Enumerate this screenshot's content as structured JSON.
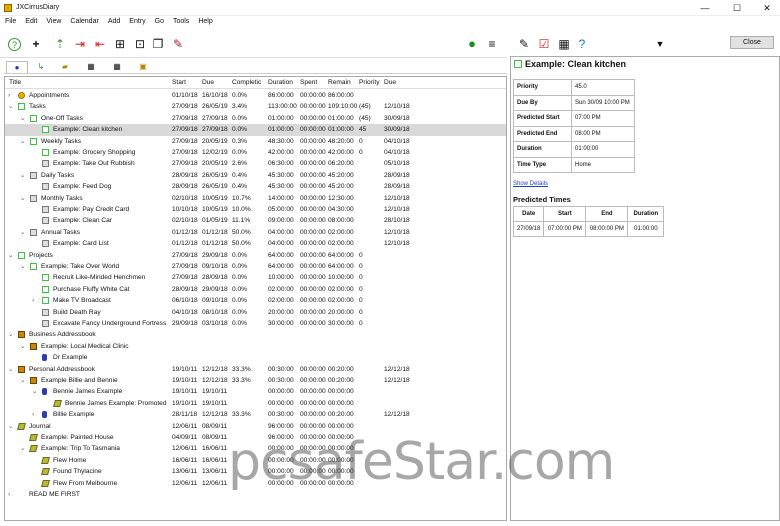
{
  "window": {
    "title": "JXCirrusDiary",
    "minimize": "—",
    "maximize": "☐",
    "close": "✕"
  },
  "menu": [
    "File",
    "Edit",
    "View",
    "Calendar",
    "Add",
    "Entry",
    "Go",
    "Tools",
    "Help"
  ],
  "columns": [
    "Title",
    "Start",
    "Due",
    "Completic",
    "Duration",
    "Spent",
    "Remain",
    "Priority",
    "Due"
  ],
  "rows": [
    {
      "exp": "›",
      "icon": "appt",
      "title": "Appointments",
      "start": "01/10/18",
      "due": "16/10/18",
      "comp": "0.0%",
      "dur": "86:00:00",
      "spent": "00:00:00",
      "remain": "86:00:00",
      "pri": "",
      "due2": ""
    },
    {
      "exp": "⌄",
      "icon": "task",
      "title": "Tasks",
      "start": "27/09/18",
      "due": "26/05/19",
      "comp": "3.4%",
      "dur": "113:00:00",
      "spent": "00:00:00",
      "remain": "109:10:00",
      "pri": "(45)",
      "due2": "12/10/18"
    },
    {
      "exp": "⌄",
      "icon": "task",
      "title": "One-Off Tasks",
      "start": "27/09/18",
      "due": "27/09/18",
      "comp": "0.0%",
      "dur": "01:00:00",
      "spent": "00:00:00",
      "remain": "01:00:00",
      "pri": "(45)",
      "due2": "30/09/18"
    },
    {
      "exp": "",
      "icon": "task",
      "title": "Example: Clean kitchen",
      "start": "27/09/18",
      "due": "27/09/18",
      "comp": "0.0%",
      "dur": "01:00:00",
      "spent": "00:00:00",
      "remain": "01:00:00",
      "pri": "45",
      "due2": "30/09/18",
      "sel": true
    },
    {
      "exp": "⌄",
      "icon": "task",
      "title": "Weekly Tasks",
      "start": "27/09/18",
      "due": "20/05/19",
      "comp": "0.3%",
      "dur": "48:30:00",
      "spent": "00:00:00",
      "remain": "48:20:00",
      "pri": "0",
      "due2": "04/10/18"
    },
    {
      "exp": "",
      "icon": "task",
      "title": "Example: Grocery Shopping",
      "start": "27/09/18",
      "due": "12/02/19",
      "comp": "0.0%",
      "dur": "42:00:00",
      "spent": "00:00:00",
      "remain": "42:00:00",
      "pri": "0",
      "due2": "04/10/18"
    },
    {
      "exp": "",
      "icon": "gray",
      "title": "Example: Take Out Rubbish",
      "start": "27/09/18",
      "due": "20/05/19",
      "comp": "2.6%",
      "dur": "06:30:00",
      "spent": "00:00:00",
      "remain": "06:20:00",
      "pri": "",
      "due2": "05/10/18"
    },
    {
      "exp": "⌄",
      "icon": "gray",
      "title": "Daily Tasks",
      "start": "28/09/18",
      "due": "26/05/19",
      "comp": "0.4%",
      "dur": "45:30:00",
      "spent": "00:00:00",
      "remain": "45:20:00",
      "pri": "",
      "due2": "28/09/18"
    },
    {
      "exp": "",
      "icon": "gray",
      "title": "Example: Feed Dog",
      "start": "28/09/18",
      "due": "26/05/19",
      "comp": "0.4%",
      "dur": "45:30:00",
      "spent": "00:00:00",
      "remain": "45:20:00",
      "pri": "",
      "due2": "28/09/18"
    },
    {
      "exp": "⌄",
      "icon": "gray",
      "title": "Monthly Tasks",
      "start": "02/10/18",
      "due": "10/05/19",
      "comp": "10.7%",
      "dur": "14:00:00",
      "spent": "00:00:00",
      "remain": "12:30:00",
      "pri": "",
      "due2": "12/10/18"
    },
    {
      "exp": "",
      "icon": "gray",
      "title": "Example: Pay Credit Card",
      "start": "10/10/18",
      "due": "10/05/19",
      "comp": "10.0%",
      "dur": "05:00:00",
      "spent": "00:00:00",
      "remain": "04:30:00",
      "pri": "",
      "due2": "12/10/18"
    },
    {
      "exp": "",
      "icon": "gray",
      "title": "Example: Clean Car",
      "start": "02/10/18",
      "due": "01/05/19",
      "comp": "11.1%",
      "dur": "09:00:00",
      "spent": "00:00:00",
      "remain": "08:00:00",
      "pri": "",
      "due2": "28/10/18"
    },
    {
      "exp": "⌄",
      "icon": "gray",
      "title": "Annual Tasks",
      "start": "01/12/18",
      "due": "01/12/18",
      "comp": "50.0%",
      "dur": "04:00:00",
      "spent": "00:00:00",
      "remain": "02:00:00",
      "pri": "",
      "due2": "12/10/18"
    },
    {
      "exp": "",
      "icon": "gray",
      "title": "Example: Card List",
      "start": "01/12/18",
      "due": "01/12/18",
      "comp": "50.0%",
      "dur": "04:00:00",
      "spent": "00:00:00",
      "remain": "02:00:00",
      "pri": "",
      "due2": "12/10/18"
    },
    {
      "exp": "⌄",
      "icon": "task",
      "title": "Projects",
      "start": "27/09/18",
      "due": "29/09/18",
      "comp": "0.0%",
      "dur": "64:00:00",
      "spent": "00:00:00",
      "remain": "64:00:00",
      "pri": "0",
      "due2": ""
    },
    {
      "exp": "⌄",
      "icon": "task",
      "title": "Example: Take Over World",
      "start": "27/09/18",
      "due": "09/10/18",
      "comp": "0.0%",
      "dur": "64:00:00",
      "spent": "00:00:00",
      "remain": "64:00:00",
      "pri": "0",
      "due2": ""
    },
    {
      "exp": "",
      "icon": "task",
      "title": "Recruit Like-Minded Henchmen",
      "start": "27/09/18",
      "due": "28/09/18",
      "comp": "0.0%",
      "dur": "10:00:00",
      "spent": "00:00:00",
      "remain": "10:00:00",
      "pri": "0",
      "due2": ""
    },
    {
      "exp": "",
      "icon": "task",
      "title": "Purchase Fluffy White Cat",
      "start": "28/09/18",
      "due": "29/09/18",
      "comp": "0.0%",
      "dur": "02:00:00",
      "spent": "00:00:00",
      "remain": "02:00:00",
      "pri": "0",
      "due2": ""
    },
    {
      "exp": "›",
      "icon": "task",
      "title": "Make TV Broadcast",
      "start": "06/10/18",
      "due": "09/10/18",
      "comp": "0.0%",
      "dur": "02:00:00",
      "spent": "00:00:00",
      "remain": "02:00:00",
      "pri": "0",
      "due2": ""
    },
    {
      "exp": "",
      "icon": "gray",
      "title": "Build Death Ray",
      "start": "04/10/18",
      "due": "08/10/18",
      "comp": "0.0%",
      "dur": "20:00:00",
      "spent": "00:00:00",
      "remain": "20:00:00",
      "pri": "0",
      "due2": ""
    },
    {
      "exp": "",
      "icon": "gray",
      "title": "Excavate Fancy Underground Fortress",
      "start": "29/09/18",
      "due": "03/10/18",
      "comp": "0.0%",
      "dur": "30:00:00",
      "spent": "00:00:00",
      "remain": "30:00:00",
      "pri": "0",
      "due2": ""
    },
    {
      "exp": "⌄",
      "icon": "book",
      "title": "Business Addressbook",
      "start": "",
      "due": "",
      "comp": "",
      "dur": "",
      "spent": "",
      "remain": "",
      "pri": "",
      "due2": ""
    },
    {
      "exp": "⌄",
      "icon": "book",
      "title": "Example: Local Medical Clinic",
      "start": "",
      "due": "",
      "comp": "",
      "dur": "",
      "spent": "",
      "remain": "",
      "pri": "",
      "due2": ""
    },
    {
      "exp": "",
      "icon": "person",
      "title": "Dr Example",
      "start": "",
      "due": "",
      "comp": "",
      "dur": "",
      "spent": "",
      "remain": "",
      "pri": "",
      "due2": ""
    },
    {
      "exp": "⌄",
      "icon": "book",
      "title": "Personal Addressbook",
      "start": "19/10/11",
      "due": "12/12/18",
      "comp": "33.3%",
      "dur": "00:30:00",
      "spent": "00:00:00",
      "remain": "00:20:00",
      "pri": "",
      "due2": "12/12/18"
    },
    {
      "exp": "⌄",
      "icon": "book",
      "title": "Example Billie and Bennie",
      "start": "19/10/11",
      "due": "12/12/18",
      "comp": "33.3%",
      "dur": "00:30:00",
      "spent": "00:00:00",
      "remain": "00:20:00",
      "pri": "",
      "due2": "12/12/18"
    },
    {
      "exp": "⌄",
      "icon": "person",
      "title": "Bennie James Example",
      "start": "19/10/11",
      "due": "19/10/11",
      "comp": "",
      "dur": "00:00:00",
      "spent": "00:00:00",
      "remain": "00:00:00",
      "pri": "",
      "due2": ""
    },
    {
      "exp": "",
      "icon": "journal",
      "title": "Bennie James Example: Promoted",
      "start": "19/10/11",
      "due": "19/10/11",
      "comp": "",
      "dur": "00:00:00",
      "spent": "00:00:00",
      "remain": "00:00:00",
      "pri": "",
      "due2": ""
    },
    {
      "exp": "›",
      "icon": "person",
      "title": "Billie Example",
      "start": "28/11/18",
      "due": "12/12/18",
      "comp": "33.3%",
      "dur": "00:30:00",
      "spent": "00:00:00",
      "remain": "00:20:00",
      "pri": "",
      "due2": "12/12/18"
    },
    {
      "exp": "⌄",
      "icon": "journal",
      "title": "Journal",
      "start": "12/06/11",
      "due": "08/09/11",
      "comp": "",
      "dur": "96:00:00",
      "spent": "00:00:00",
      "remain": "00:00:00",
      "pri": "",
      "due2": ""
    },
    {
      "exp": "",
      "icon": "journal",
      "title": "Example: Painted House",
      "start": "04/09/11",
      "due": "08/09/11",
      "comp": "",
      "dur": "96:00:00",
      "spent": "00:00:00",
      "remain": "00:00:00",
      "pri": "",
      "due2": ""
    },
    {
      "exp": "⌄",
      "icon": "journal",
      "title": "Example: Trip To Tasmania",
      "start": "12/06/11",
      "due": "16/06/11",
      "comp": "",
      "dur": "00:00:00",
      "spent": "00:00:00",
      "remain": "00:00:00",
      "pri": "",
      "due2": ""
    },
    {
      "exp": "",
      "icon": "journal",
      "title": "Flew Home",
      "start": "16/06/11",
      "due": "16/06/11",
      "comp": "",
      "dur": "00:00:00",
      "spent": "00:00:00",
      "remain": "00:00:00",
      "pri": "",
      "due2": ""
    },
    {
      "exp": "",
      "icon": "journal",
      "title": "Found Thylacine",
      "start": "13/06/11",
      "due": "13/06/11",
      "comp": "",
      "dur": "00:00:00",
      "spent": "00:00:00",
      "remain": "00:00:00",
      "pri": "",
      "due2": ""
    },
    {
      "exp": "",
      "icon": "journal",
      "title": "Flew From Melbourne",
      "start": "12/06/11",
      "due": "12/06/11",
      "comp": "",
      "dur": "00:00:00",
      "spent": "00:00:00",
      "remain": "00:00:00",
      "pri": "",
      "due2": ""
    },
    {
      "exp": "›",
      "icon": "none",
      "title": "READ ME FIRST",
      "start": "",
      "due": "",
      "comp": "",
      "dur": "",
      "spent": "",
      "remain": "",
      "pri": "",
      "due2": ""
    }
  ],
  "detail": {
    "title": "Example: Clean kitchen",
    "close_label": "Close",
    "props": [
      {
        "k": "Priority",
        "v": "45.0"
      },
      {
        "k": "Due By",
        "v": "Sun 30/09 10:00 PM"
      },
      {
        "k": "Predicted Start",
        "v": "07:00 PM"
      },
      {
        "k": "Predicted End",
        "v": "08:00 PM"
      },
      {
        "k": "Duration",
        "v": "01:00:00"
      },
      {
        "k": "Time Type",
        "v": "Home"
      }
    ],
    "show_details": "Show Details",
    "predicted_title": "Predicted Times",
    "pred_headers": [
      "Date",
      "Start",
      "End",
      "Duration"
    ],
    "pred_row": [
      "27/09/18",
      "07:00:00 PM",
      "08:00:00 PM",
      "01:00:00"
    ]
  },
  "watermark": "pcsafeStar.com"
}
